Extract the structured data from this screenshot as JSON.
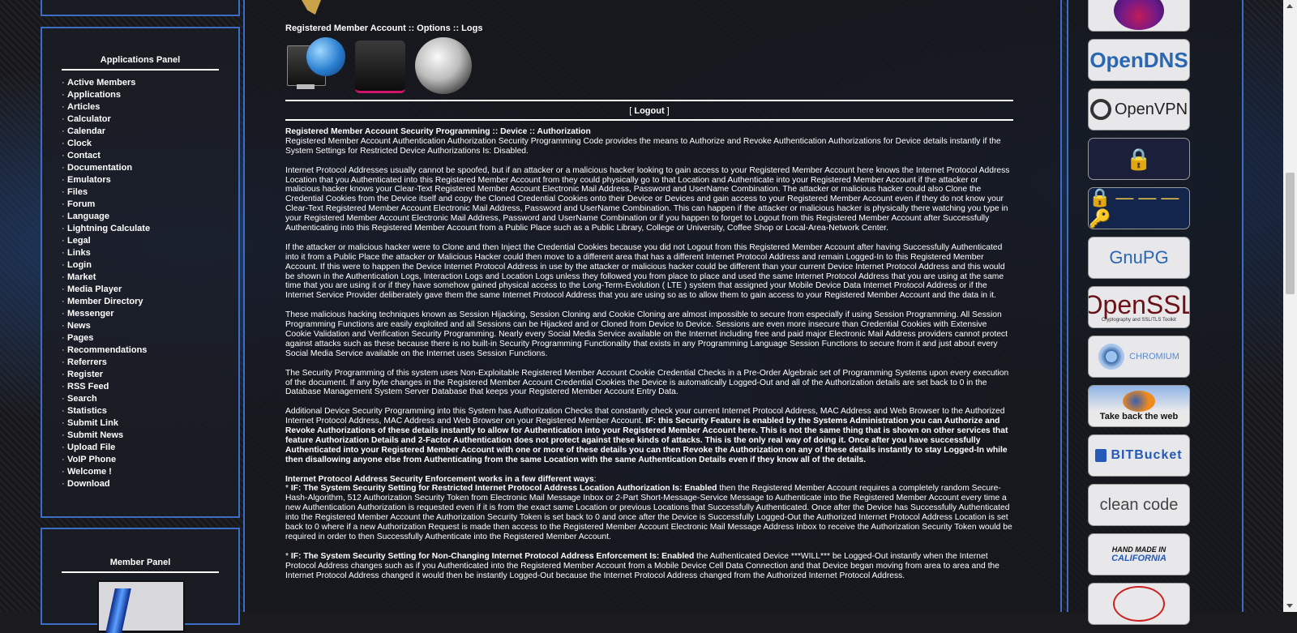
{
  "applications_panel": {
    "title": "Applications Panel",
    "bullet": "·",
    "items": [
      "Active Members",
      "Applications",
      "Articles",
      "Calculator",
      "Calendar",
      "Clock",
      "Contact",
      "Documentation",
      "Emulators",
      "Files",
      "Forum",
      "Language",
      "Lightning Calculate",
      "Legal",
      "Links",
      "Login",
      "Market",
      "Media Player",
      "Member Directory",
      "Messenger",
      "News",
      "Pages",
      "Recommendations",
      "Referrers",
      "Register",
      "RSS Feed",
      "Search",
      "Statistics",
      "Submit Link",
      "Submit News",
      "Upload File",
      "VoIP Phone",
      "Welcome !",
      "Download"
    ]
  },
  "member_panel": {
    "title": "Member Panel"
  },
  "main": {
    "breadcrumb": "Registered Member Account :: Options :: Logs",
    "logout": {
      "open": "[ ",
      "label": "Logout",
      "close": " ]"
    },
    "heading": "Registered Member Account Security Programming :: Device :: Authorization",
    "p1": "Registered Member Account Authentication Authorization Security Programming Code provides the means to Authorize and Revoke Authentication Authorizations for Device details instantly if the System Settings for Restricted Device Authorizations Is: Disabled.",
    "p2": "Internet Protocol Addresses usually cannot be spoofed, but if an attacker or a malicious hacker looking to gain access to your Registered Member Account here knows the Internet Protocol Address Location that you Authenticated into this Registered Member Account from they could physically go to that Location and Authenticate into your Registered Member Account if the attacker or malicious hacker knows your Clear-Text Registered Member Account Electronic Mail Address, Password and UserName Combination. The attacker or malicious hacker could also Clone the Credential Cookies from the Device itself and copy the Cloned Credential Cookies onto their Device or Devices and gain access to your Registered Member Account even if they do not know your Clear-Text Registered Member Account Electronic Mail Address, Password and UserName Combination. This can happen if the attacker or malicious hacker is physically there watching you type in your Registered Member Account Electronic Mail Address, Password and UserName Combination or if you happen to forget to Logout from this Registered Member Account after Successfully Authenticating into this Registered Member Account from a Public Place such as a Public Library, College or University, Coffee Shop or Local-Area-Network Center.",
    "p3": "If the attacker or malicious hacker were to Clone and then Inject the Credential Cookies because you did not Logout from this Registered Member Account after having Successfully Authenticated into it from a Public Place the attacker or Malicious Hacker could then move to a different area that has a different Internet Protocol Address and remain Logged-In to this Registered Member Account. If this were to happen the Device Internet Protocol Address in use by the attacker or malicious hacker could be different than your current Device Internet Protocol Address and this would be shown in the Authentication Logs, Interaction Logs and Location Logs unless they followed you from place to place and used the same Internet Protocol Address that you are using at the same time that you are using it or if they have somehow gained physical access to the Long-Term-Evolution ( LTE ) system that assigned your Mobile Device Data Internet Protocol Address or if the Internet Service Provider deliberately gave them the same Internet Protocol Address that you are using so as to allow them to gain access to your Registered Member Account and the data in it.",
    "p4": "These malicious hacking techniques known as Session Hijacking, Session Cloning and Cookie Cloning are almost impossible to secure from especially if using Session Programming. All Session Programming Functions are easily exploited and all Sessions can be Hijacked and or Cloned from Device to Device. Sessions are even more insecure than Credential Cookies with Extensive Cookie Validation and Verification Security Programming. Nearly every Social Media Service available on the Internet including free and paid major Electronic Mail Address providers cannot protect against attacks such as these because there is no built-in Security Programming Functionality that exists in any Programming Language Session Functions to secure from it and just about every Social Media Service available on the Internet uses Session Functions.",
    "p5": "The Security Programming of this system uses Non-Exploitable Registered Member Account Cookie Credential Checks in a Pre-Order Algebraic set of Programming Systems upon every execution of the document. If any byte changes in the Registered Member Account Credential Cookies the Device is automatically Logged-Out and all of the Authorization details are set back to 0 in the Database Management System Server Database that keeps your Registered Member Account Entry Data.",
    "p6a": "Additional Device Security Programming into this System has Authorization Checks that constantly check your current Internet Protocol Address, MAC Address and Web Browser to the Authorized Internet Protocol Address, MAC Address and Web Browser on your Registered Member Account. ",
    "p6b": "IF: this Security Feature is enabled by the Systems Administration you can Authorize and Revoke Authorizations of these details instantly to allow for Authentication into your Registered Member Account here. This is not the same thing that is shown on other services that feature Authorization Details and 2-Factor Authentication does not protect against these kinds of attacks. This is the only real way of doing it. Once after you have successfully Authenticated into your Registered Member Account with one or more of these details you can then Revoke the Authorization on any of these details instantly to stay Logged-In while then disallowing anyone else from Authenticating from the same Location with the same Authentication Details even if they know all of the details.",
    "p7_head": "Internet Protocol Address Security Enforcement works in a few different ways",
    "p7_colon": ":",
    "p8_star": "* ",
    "p8_bold": "IF: The System Security Setting for Restricted Internet Protocol Address Location Authorization Is: Enabled",
    "p8_rest": " then the Registered Member Account requires a completely random Secure-Hash-Algorithm, 512 Authorization Security Token from Electronic Mail Message Inbox or 2-Part Short-Message-Service Message to Authenticate into the Registered Member Account every time a new Authentication Authorization is requested even if it is from the exact same Location or previous Locations that Successfully Authenticated. Once after the Device has Successfully Authenticated into the Registered Member Account the Authorization Security Token is set back to 0 and once after the Device is Successfully Logged-Out the Authorized Internet Protocol Address Location is set back to 0 where if a new Authorization Request is made then access to the Registered Member Account Electronic Mail Message Address Inbox to receive the Authorization Security Token would be required in order to then Successfully Authenticate into the Registered Member Account.",
    "p9_star": "* ",
    "p9_bold": "IF: The System Security Setting for Non-Changing Internet Protocol Address Enforcement Is: Enabled",
    "p9_rest": " the Authenticated Device ***WILL*** be Logged-Out instantly when the Internet Protocol Address changes such as if you Authenticated into the Registered Member Account from a Mobile Device Cell Data Connection and that Device began moving from area to area and the Internet Protocol Address changed it would then be instantly Logged-Out because the Internet Protocol Address changed from the Authorized Internet Protocol Address."
  },
  "badges": [
    {
      "name": "opendns",
      "text": "OpenDNS"
    },
    {
      "name": "openvpn",
      "text": "OpenVPN"
    },
    {
      "name": "gnupg",
      "text": "GnuPG"
    },
    {
      "name": "openssl",
      "text": "OpenSSL",
      "sub": "Cryptography and SSL/TLS Toolkit"
    },
    {
      "name": "chromium",
      "text": "CHROMIUM"
    },
    {
      "name": "firefox",
      "text": "Take back the web"
    },
    {
      "name": "bitbucket",
      "text": "BITBucket"
    },
    {
      "name": "cleancode",
      "text": "clean code"
    },
    {
      "name": "handmade",
      "text": "HAND MADE IN",
      "sub": "CALIFORNIA"
    }
  ],
  "colors": {
    "panel_border": "#3c6cc4",
    "opendns_blue": "#2a67b1",
    "openssl_red": "#6b1219"
  }
}
